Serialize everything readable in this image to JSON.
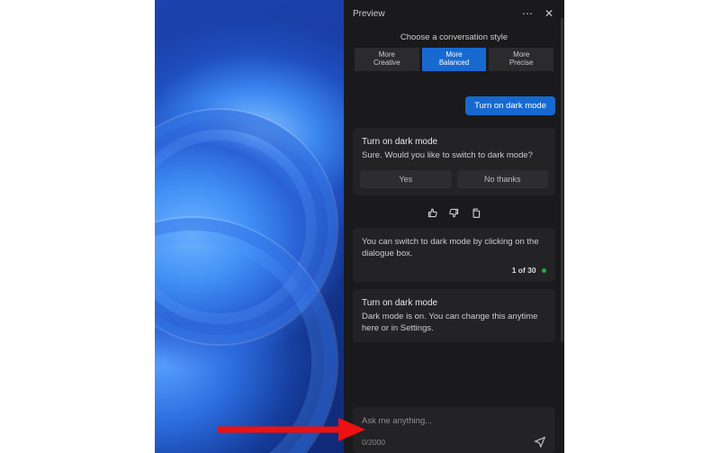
{
  "header": {
    "title": "Preview"
  },
  "style": {
    "caption": "Choose a conversation style",
    "options": [
      {
        "line1": "More",
        "line2": "Creative"
      },
      {
        "line1": "More",
        "line2": "Balanced"
      },
      {
        "line1": "More",
        "line2": "Precise"
      }
    ]
  },
  "chat": {
    "user_msg": "Turn on dark mode",
    "card1": {
      "title": "Turn on dark mode",
      "text": "Sure. Would you like to switch to dark mode?",
      "yes": "Yes",
      "no": "No thanks"
    },
    "card2": {
      "text": "You can switch to dark mode by clicking on the dialogue box.",
      "progress_num": "1 of 30"
    },
    "card3": {
      "title": "Turn on dark mode",
      "text": "Dark mode is on. You can change this anytime here or in Settings."
    }
  },
  "input": {
    "placeholder": "Ask me anything...",
    "counter": "0/2000"
  }
}
